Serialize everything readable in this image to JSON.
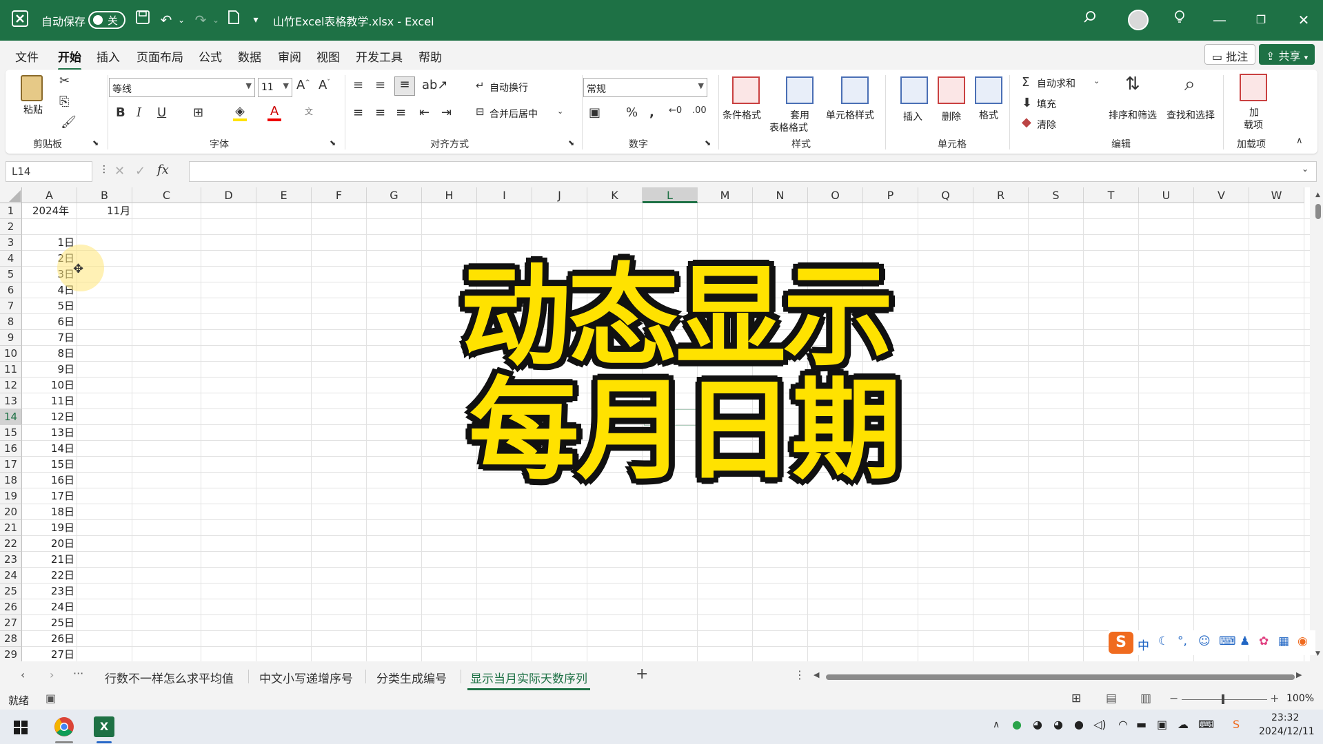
{
  "titlebar": {
    "autosave_label": "自动保存",
    "autosave_state": "关",
    "filename": "山竹Excel表格教学.xlsx - Excel",
    "icons": [
      "excel-icon",
      "save-icon",
      "undo-icon",
      "redo-icon",
      "touch-mode-icon",
      "customize-icon",
      "search-icon",
      "avatar",
      "lightbulb-icon",
      "minimize-icon",
      "restore-icon",
      "close-icon"
    ]
  },
  "menu": {
    "tabs": [
      "文件",
      "开始",
      "插入",
      "页面布局",
      "公式",
      "数据",
      "审阅",
      "视图",
      "开发工具",
      "帮助"
    ],
    "active": "开始",
    "comment_btn": "批注",
    "share_btn": "共享"
  },
  "ribbon": {
    "clipboard": {
      "paste": "粘贴",
      "group": "剪贴板"
    },
    "font": {
      "name": "等线",
      "size": "11",
      "group": "字体"
    },
    "alignment": {
      "wrap": "自动换行",
      "merge": "合并后居中",
      "group": "对齐方式"
    },
    "number": {
      "format": "常规",
      "group": "数字"
    },
    "styles": {
      "conditional": "条件格式",
      "table_fmt_1": "套用",
      "table_fmt_2": "表格格式",
      "cell_style": "单元格样式",
      "group": "样式"
    },
    "cells": {
      "insert": "插入",
      "delete": "删除",
      "format": "格式",
      "group": "单元格"
    },
    "editing": {
      "autosum": "自动求和",
      "fill": "填充",
      "clear": "清除",
      "sort": "排序和筛选",
      "find": "查找和选择",
      "group": "编辑"
    },
    "addins": {
      "label_1": "加",
      "label_2": "载项",
      "group": "加载项"
    }
  },
  "formula_bar": {
    "name_box": "L14",
    "fx": "fx",
    "content": ""
  },
  "grid": {
    "columns": [
      "A",
      "B",
      "C",
      "D",
      "E",
      "F",
      "G",
      "H",
      "I",
      "J",
      "K",
      "L",
      "M",
      "N",
      "O",
      "P",
      "Q",
      "R",
      "S",
      "T",
      "U",
      "V",
      "W"
    ],
    "selected_column": "L",
    "rows": [
      "1",
      "2",
      "3",
      "4",
      "5",
      "6",
      "7",
      "8",
      "9",
      "10",
      "11",
      "12",
      "13",
      "14",
      "15",
      "16",
      "17",
      "18",
      "19",
      "20",
      "21",
      "22",
      "23",
      "24",
      "25",
      "26",
      "27",
      "28",
      "29"
    ],
    "selected_row": "14",
    "a1": "2024年",
    "b1": "11月",
    "days": [
      "1日",
      "2日",
      "3日",
      "4日",
      "5日",
      "6日",
      "7日",
      "8日",
      "9日",
      "10日",
      "11日",
      "12日",
      "13日",
      "14日",
      "15日",
      "16日",
      "17日",
      "18日",
      "19日",
      "20日",
      "21日",
      "22日",
      "23日",
      "24日",
      "25日",
      "26日",
      "27日"
    ]
  },
  "overlay": {
    "line1": "动态显示",
    "line2": "每月日期",
    "text_color": "#ffe200",
    "outline_color": "#111111"
  },
  "sheets": {
    "tabs": [
      "行数不一样怎么求平均值",
      "中文小写递增序号",
      "分类生成编号",
      "显示当月实际天数序列"
    ],
    "active": "显示当月实际天数序列",
    "add": "+"
  },
  "status": {
    "ready": "就绪",
    "zoom": "100%"
  },
  "taskbar": {
    "time": "23:32",
    "date": "2024/12/11",
    "ime_label": "中"
  },
  "colors": {
    "excel_green": "#1e7145",
    "overlay_yellow": "#ffe200"
  }
}
